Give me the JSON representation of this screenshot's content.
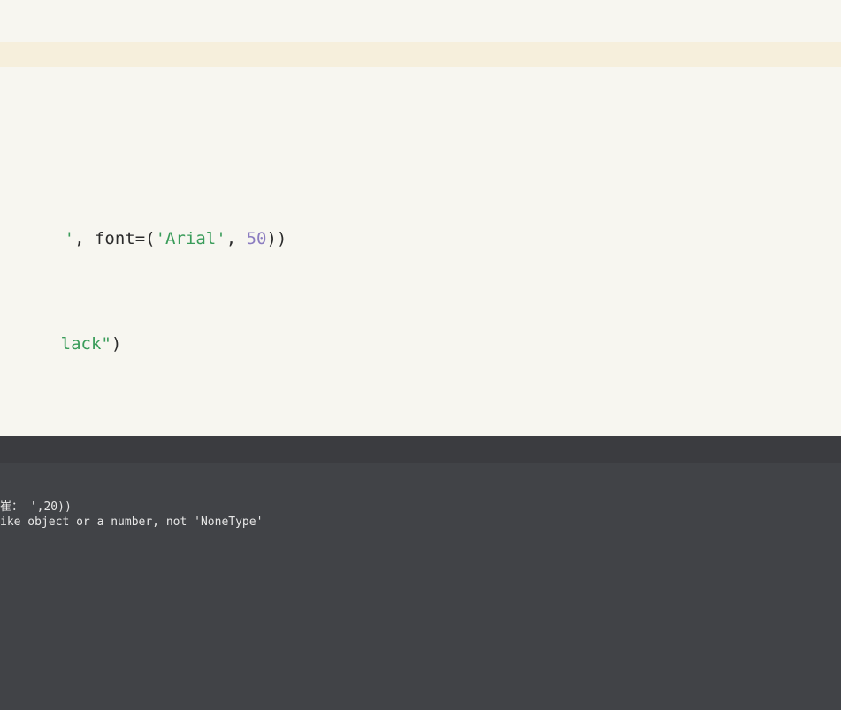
{
  "editor": {
    "line_font_tokens": [
      {
        "text": "'",
        "kind": "str"
      },
      {
        "text": ", font=(",
        "kind": "plain"
      },
      {
        "text": "'Arial'",
        "kind": "str"
      },
      {
        "text": ", ",
        "kind": "plain"
      },
      {
        "text": "50",
        "kind": "num"
      },
      {
        "text": "))",
        "kind": "plain"
      }
    ],
    "line_color_tokens": [
      {
        "text": "lack\"",
        "kind": "str"
      },
      {
        "text": ")",
        "kind": "plain"
      }
    ]
  },
  "console": {
    "lines": [
      "崔： ',20))",
      "ike object or a number, not 'NoneType'"
    ]
  },
  "colors": {
    "editor_bg": "#f7f6f0",
    "active_line_bg": "#f6efdc",
    "string": "#3a9c5a",
    "number": "#8b7cc0",
    "console_bg": "#414347",
    "console_header_bg": "#3b3c40",
    "console_text": "#e6e6e6"
  }
}
